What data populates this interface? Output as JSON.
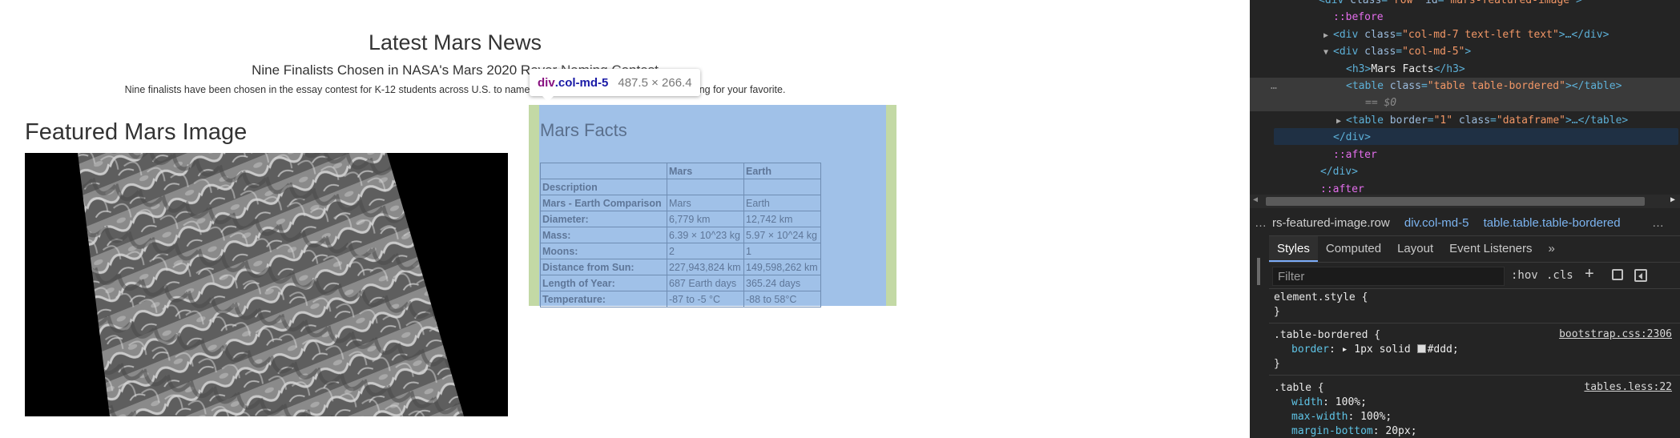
{
  "page": {
    "news_title": "Latest Mars News",
    "news_headline": "Nine Finalists Chosen in NASA's Mars 2020 R",
    "news_headline_hidden": "over Naming Contest",
    "news_teaser_left": "Nine finalists have been chosen in the essay contest for K-12 students across U.S. to name NAS",
    "news_teaser_right": "by voting for your favorite.",
    "featured_title": "Featured Mars Image",
    "facts_title": "Mars Facts",
    "facts_table": {
      "headers": [
        "",
        "Mars",
        "Earth"
      ],
      "rows": [
        [
          "Description",
          "",
          ""
        ],
        [
          "Mars - Earth Comparison",
          "Mars",
          "Earth"
        ],
        [
          "Diameter:",
          "6,779 km",
          "12,742 km"
        ],
        [
          "Mass:",
          "6.39 × 10^23 kg",
          "5.97 × 10^24 kg"
        ],
        [
          "Moons:",
          "2",
          "1"
        ],
        [
          "Distance from Sun:",
          "227,943,824 km",
          "149,598,262 km"
        ],
        [
          "Length of Year:",
          "687 Earth days",
          "365.24 days"
        ],
        [
          "Temperature:",
          "-87 to -5 °C",
          "-88 to 58°C"
        ]
      ]
    },
    "tooltip": {
      "tag": "div",
      "cls": ".col-md-5",
      "dims": "487.5 × 266.4"
    }
  },
  "devtools": {
    "dom": {
      "l0_prefix": "<div class=\"row\" id=\"mars-featured-image\">",
      "l1": "::before",
      "l2_tag_open": "<div ",
      "l2_attr": "class",
      "l2_val": "\"col-md-7 text-left text\"",
      "l2_rest": ">…</div>",
      "l3_tag_open": "<div ",
      "l3_attr": "class",
      "l3_val": "\"col-md-5\"",
      "l3_close": ">",
      "l4_open": "<h3>",
      "l4_text": "Mars Facts",
      "l4_close": "</h3>",
      "l5_open": "<table ",
      "l5_attr": "class",
      "l5_val": "\"table table-bordered\"",
      "l5_close": "></table>",
      "l5_ref": "== $0",
      "l6_open": "<table ",
      "l6_attr1": "border",
      "l6_val1": "\"1\"",
      "l6_attr2": "class",
      "l6_val2": "\"dataframe\"",
      "l6_close": ">…</table>",
      "l7": "</div>",
      "l8": "::after",
      "l9": "</div>",
      "l10": "::after",
      "ellipsis": "…"
    },
    "breadcrumbs": [
      "rs-featured-image.row",
      "div.col-md-5",
      "table.table.table-bordered"
    ],
    "breadcrumb_ellipsis": "…",
    "tabs": [
      "Styles",
      "Computed",
      "Layout",
      "Event Listeners"
    ],
    "tabs_more": "»",
    "filter_placeholder": "Filter",
    "hov_label": ":hov",
    "cls_label": ".cls",
    "plus_label": "+",
    "rules": {
      "element_style": "element.style {",
      "close": "}",
      "bordered_selector": ".table-bordered {",
      "bordered_source": "bootstrap.css:2306",
      "bordered_prop": "border",
      "bordered_val": "1px solid",
      "bordered_color": "#ddd;",
      "table_selector": ".table {",
      "table_source": "tables.less:22",
      "width_prop": "width",
      "width_val": "100%;",
      "maxw_prop": "max-width",
      "maxw_val": "100%;",
      "mb_prop": "margin-bottom",
      "mb_val": "20px;"
    }
  },
  "colors": {
    "highlight_content": "#a0c1e8",
    "highlight_padding": "#c3d9a5",
    "devtools_bg": "#242424"
  }
}
